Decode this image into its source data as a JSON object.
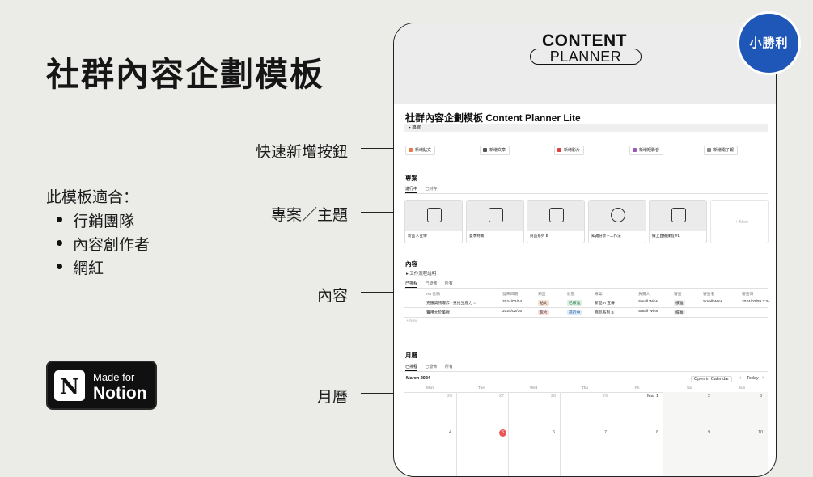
{
  "title": "社群內容企劃模板",
  "suitability": {
    "heading": "此模板適合：",
    "items": [
      "行銷團隊",
      "內容創作者",
      "網紅"
    ]
  },
  "notion_badge": {
    "line1": "Made for",
    "line2": "Notion",
    "logo_letter": "N"
  },
  "callouts": {
    "quick_add": "快速新增按鈕",
    "projects": "專案／主題",
    "content": "內容",
    "calendar": "月曆"
  },
  "brand_badge": "小勝利",
  "cover": {
    "line1": "CONTENT",
    "line2": "PLANNER"
  },
  "notion_page": {
    "title": "社群內容企劃模板 Content Planner Lite",
    "guide_toggle": "▸ 導覽",
    "quick_buttons": [
      {
        "label": "新增貼文",
        "color": "#e97a4a"
      },
      {
        "label": "新增文章",
        "color": "#555555"
      },
      {
        "label": "新增影片",
        "color": "#e03e3e"
      },
      {
        "label": "新增短影音",
        "color": "#9b59b6"
      },
      {
        "label": "新增電子報",
        "color": "#888888"
      }
    ],
    "projects": {
      "title": "專案",
      "tabs": [
        "進行中",
        "已封存"
      ],
      "cards": [
        "新品 A 宣傳",
        "夏季特賣",
        "商品系列 B",
        "知識分享－工作法",
        "線上直播課程 #1"
      ],
      "new_label": "+ New"
    },
    "content": {
      "title": "內容",
      "workflow_toggle": "▸ 工作流程說明",
      "tabs": [
        "已排程",
        "已發佈",
        "所有"
      ],
      "columns": [
        "Aa 名稱",
        "發佈日期",
        "類型",
        "狀態",
        "專案",
        "負責人",
        "審查",
        "審查者",
        "審查日"
      ],
      "rows": [
        {
          "name": "克服資訊爆炸 - 重拾生產力",
          "comments": "2",
          "date": "2024/02/04",
          "type": "貼文",
          "status": "已核准",
          "project": "新品 A 宣傳",
          "owner": "Small Wins",
          "review": "核准",
          "reviewer": "Small Wins",
          "review_date": "2024/02/09 3:34"
        },
        {
          "name": "實用大於美觀",
          "comments": "",
          "date": "2024/02/16",
          "type": "影片",
          "status": "進行中",
          "project": "商品系列 B",
          "owner": "Small Wins",
          "review": "核准",
          "reviewer": "",
          "review_date": ""
        }
      ],
      "new_label": "+ New"
    },
    "calendar": {
      "title": "月曆",
      "tabs": [
        "已排程",
        "已發佈",
        "所有"
      ],
      "month": "March 2024",
      "open_in_calendar": "Open in Calendar",
      "today": "Today",
      "weekdays": [
        "Mon",
        "Tue",
        "Wed",
        "Thu",
        "Fri",
        "Sat",
        "Sun"
      ],
      "week1": [
        "26",
        "27",
        "28",
        "29",
        "Mar 1",
        "2",
        "3"
      ],
      "week2": [
        "4",
        "5",
        "6",
        "7",
        "8",
        "9",
        "10"
      ]
    }
  },
  "colors": {
    "accent_blue": "#1f57b8",
    "today_red": "#eb5757"
  }
}
